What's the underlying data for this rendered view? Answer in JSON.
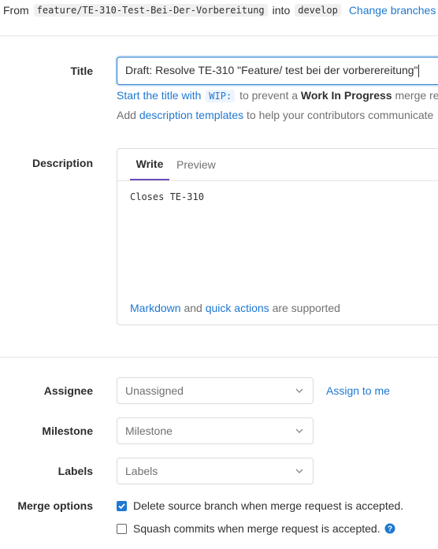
{
  "branches": {
    "from_label": "From",
    "source_branch": "feature/TE-310-Test-Bei-Der-Vorbereitung",
    "into_label": "into",
    "target_branch": "develop",
    "change_branches": "Change branches"
  },
  "title_field": {
    "label": "Title",
    "value": "Draft: Resolve TE-310 \"Feature/ test bei der vorberereitung\"",
    "hint_start": "Start the title with",
    "hint_code": "WIP:",
    "hint_mid": "to prevent a",
    "hint_bold": "Work In Progress",
    "hint_end": "merge rec",
    "templates_prefix": "Add",
    "templates_link": "description templates",
    "templates_suffix": "to help your contributors communicate"
  },
  "description": {
    "label": "Description",
    "tab_write": "Write",
    "tab_preview": "Preview",
    "body": "Closes TE-310",
    "markdown_link": "Markdown",
    "and": "and",
    "quick_actions_link": "quick actions",
    "supported": "are supported"
  },
  "assignee": {
    "label": "Assignee",
    "value": "Unassigned",
    "assign_to_me": "Assign to me"
  },
  "milestone": {
    "label": "Milestone",
    "value": "Milestone"
  },
  "labels": {
    "label": "Labels",
    "value": "Labels"
  },
  "merge_options": {
    "label": "Merge options",
    "delete_source": "Delete source branch when merge request is accepted.",
    "delete_checked": true,
    "squash": "Squash commits when merge request is accepted.",
    "squash_checked": false
  },
  "colors": {
    "accent": "#1f78d1",
    "tab_active": "#6b4fbb"
  },
  "icons": {
    "dropdown": "chevron-down-icon",
    "help": "question-circle-icon"
  }
}
